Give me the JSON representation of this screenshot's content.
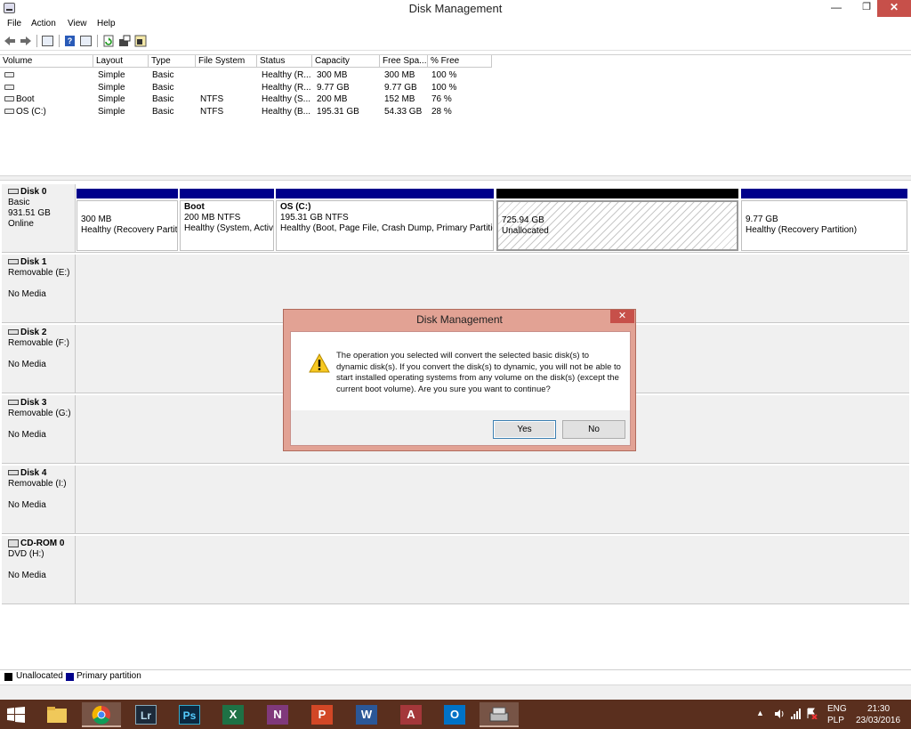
{
  "window": {
    "title": "Disk Management",
    "min_glyph": "—",
    "max_glyph": "❐",
    "close_glyph": "✕"
  },
  "menu": {
    "items": [
      "File",
      "Action",
      "View",
      "Help"
    ]
  },
  "toolbar": {
    "icons": [
      "back-arrow-icon",
      "forward-arrow-icon",
      "console-tree-icon",
      "help-icon",
      "properties-icon",
      "refresh-icon",
      "disk-settings-icon",
      "volume-settings-icon"
    ],
    "help_glyph": "?"
  },
  "volume_list": {
    "columns": [
      "Volume",
      "Layout",
      "Type",
      "File System",
      "Status",
      "Capacity",
      "Free Spa...",
      "% Free"
    ],
    "rows": [
      {
        "volume": "",
        "layout": "Simple",
        "type": "Basic",
        "fs": "",
        "status": "Healthy (R...",
        "capacity": "300 MB",
        "free": "300 MB",
        "pct": "100 %"
      },
      {
        "volume": "",
        "layout": "Simple",
        "type": "Basic",
        "fs": "",
        "status": "Healthy (R...",
        "capacity": "9.77 GB",
        "free": "9.77 GB",
        "pct": "100 %"
      },
      {
        "volume": "Boot",
        "layout": "Simple",
        "type": "Basic",
        "fs": "NTFS",
        "status": "Healthy (S...",
        "capacity": "200 MB",
        "free": "152 MB",
        "pct": "76 %"
      },
      {
        "volume": "OS (C:)",
        "layout": "Simple",
        "type": "Basic",
        "fs": "NTFS",
        "status": "Healthy (B...",
        "capacity": "195.31 GB",
        "free": "54.33 GB",
        "pct": "28 %"
      }
    ]
  },
  "disks": [
    {
      "name": "Disk 0",
      "line1": "Basic",
      "line2": "931.51 GB",
      "line3": "Online",
      "partitions": [
        {
          "title": "",
          "line1": "300 MB",
          "line2": "Healthy (Recovery Partiti"
        },
        {
          "title": "Boot",
          "line1": "200 MB NTFS",
          "line2": "Healthy (System, Activ"
        },
        {
          "title": "OS  (C:)",
          "line1": "195.31 GB NTFS",
          "line2": "Healthy (Boot, Page File, Crash Dump, Primary Partition"
        },
        {
          "title": "",
          "line1": "725.94 GB",
          "line2": "Unallocated"
        },
        {
          "title": "",
          "line1": "9.77 GB",
          "line2": "Healthy (Recovery Partition)"
        }
      ]
    },
    {
      "name": "Disk 1",
      "line1": "Removable (E:)",
      "line2": "No Media"
    },
    {
      "name": "Disk 2",
      "line1": "Removable (F:)",
      "line2": "No Media"
    },
    {
      "name": "Disk 3",
      "line1": "Removable (G:)",
      "line2": "No Media"
    },
    {
      "name": "Disk 4",
      "line1": "Removable (I:)",
      "line2": "No Media"
    },
    {
      "name": "CD-ROM 0",
      "line1": "DVD (H:)",
      "line2": "No Media"
    }
  ],
  "legend": {
    "unallocated": "Unallocated",
    "primary": "Primary partition",
    "unallocated_color": "#000000",
    "primary_color": "#00008b"
  },
  "dialog": {
    "title": "Disk Management",
    "close_glyph": "✕",
    "message": "The operation you selected will convert the selected basic disk(s) to dynamic disk(s). If you convert the disk(s) to dynamic, you will not be able to start installed operating systems from any volume on the disk(s) (except the current boot volume). Are you sure you want to continue?",
    "yes": "Yes",
    "no": "No"
  },
  "taskbar": {
    "apps": [
      {
        "name": "file-explorer",
        "label": ""
      },
      {
        "name": "chrome",
        "label": ""
      },
      {
        "name": "lightroom",
        "label": "Lr"
      },
      {
        "name": "photoshop",
        "label": "Ps"
      },
      {
        "name": "excel",
        "label": "X"
      },
      {
        "name": "onenote",
        "label": "N"
      },
      {
        "name": "powerpoint",
        "label": "P"
      },
      {
        "name": "word",
        "label": "W"
      },
      {
        "name": "access",
        "label": "A"
      },
      {
        "name": "outlook",
        "label": "O"
      },
      {
        "name": "disk-management",
        "label": ""
      }
    ],
    "lang_top": "ENG",
    "lang_bottom": "PLP",
    "time": "21:30",
    "date": "23/03/2016"
  }
}
